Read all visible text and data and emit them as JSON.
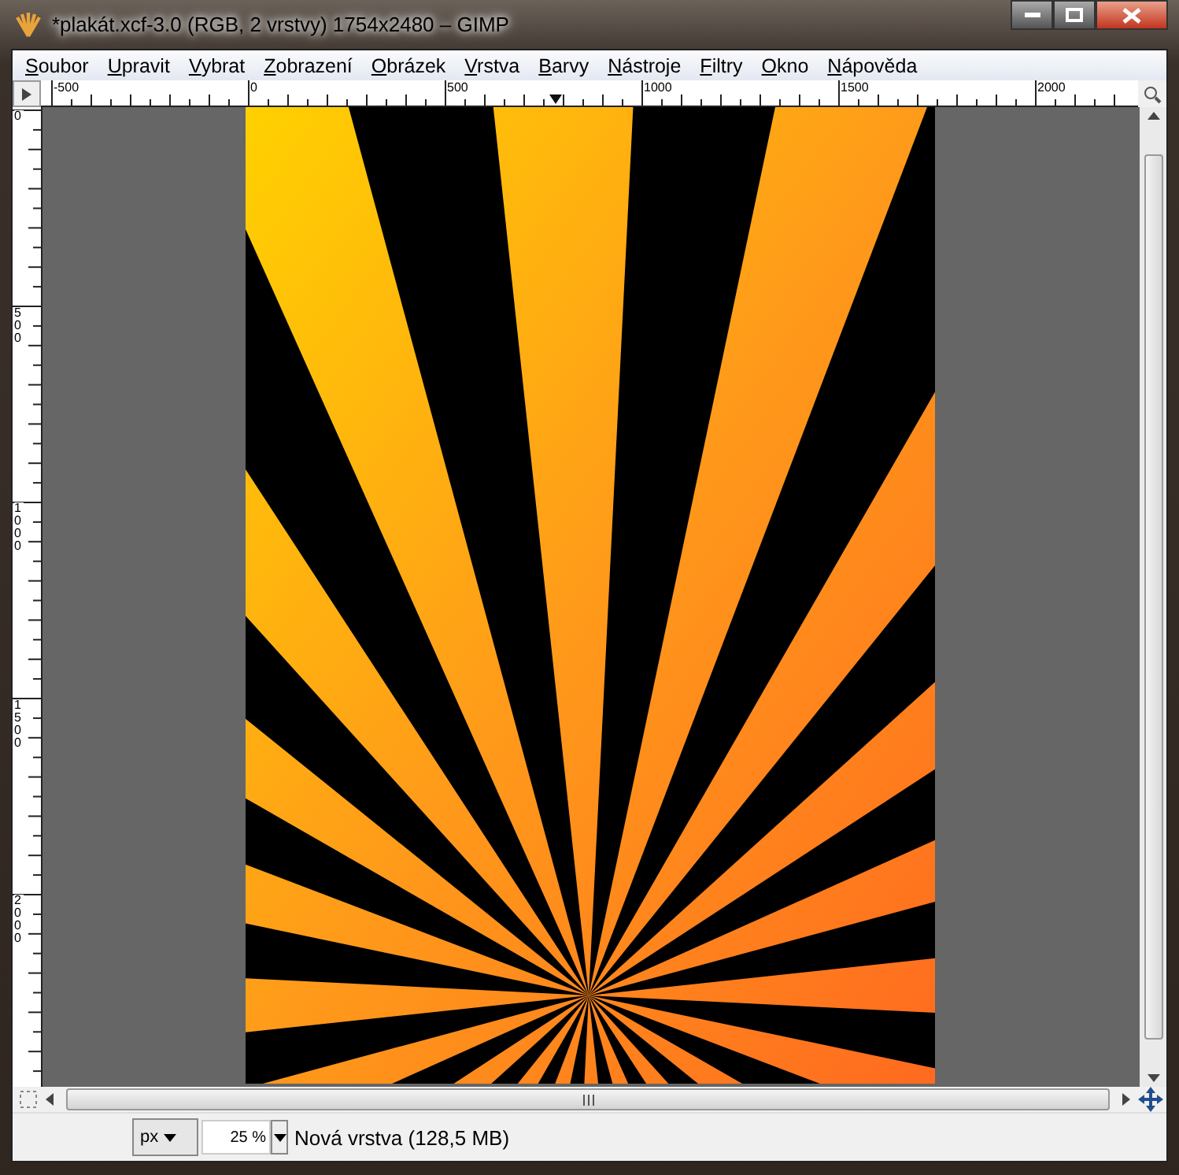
{
  "window": {
    "title": "*plakát.xcf-3.0 (RGB, 2 vrstvy) 1754x2480 – GIMP"
  },
  "menu": [
    "Soubor",
    "Upravit",
    "Vybrat",
    "Zobrazení",
    "Obrázek",
    "Vrstva",
    "Barvy",
    "Nástroje",
    "Filtry",
    "Okno",
    "Nápověda"
  ],
  "rulers": {
    "horizontal": [
      "-500",
      "0",
      "500",
      "1000",
      "1500",
      "2000"
    ],
    "vertical": [
      "0",
      "500",
      "1000",
      "1500",
      "2000"
    ]
  },
  "status_bar": {
    "unit": "px",
    "zoom": "25 %",
    "layer_info": "Nová vrstva (128,5 MB)"
  }
}
